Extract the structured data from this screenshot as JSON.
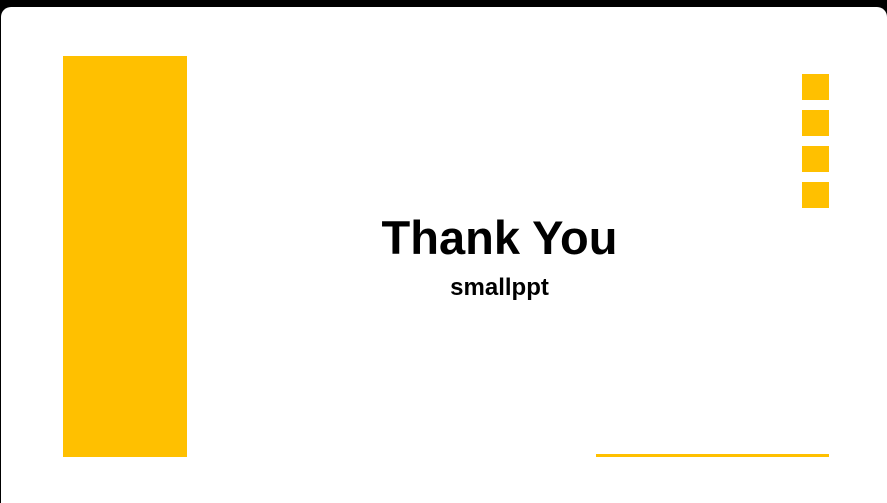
{
  "slide": {
    "title": "Thank You",
    "subtitle": "smallppt",
    "accent_color": "#FFC000",
    "background_color": "#ffffff"
  }
}
